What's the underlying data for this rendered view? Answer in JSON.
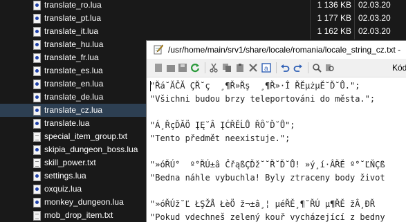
{
  "files": [
    {
      "name": "translate_ro.lua",
      "size": "1 136 KB",
      "date": "02.03.20",
      "type": "lua"
    },
    {
      "name": "translate_pt.lua",
      "size": "1 177 KB",
      "date": "02.03.20",
      "type": "lua"
    },
    {
      "name": "translate_it.lua",
      "size": "1 162 KB",
      "date": "02.03.20",
      "type": "lua"
    },
    {
      "name": "translate_hu.lua",
      "size": "",
      "date": "",
      "type": "lua"
    },
    {
      "name": "translate_fr.lua",
      "size": "",
      "date": "",
      "type": "lua"
    },
    {
      "name": "translate_es.lua",
      "size": "",
      "date": "",
      "type": "lua"
    },
    {
      "name": "translate_en.lua",
      "size": "",
      "date": "",
      "type": "lua"
    },
    {
      "name": "translate_de.lua",
      "size": "",
      "date": "",
      "type": "lua"
    },
    {
      "name": "translate_cz.lua",
      "size": "",
      "date": "",
      "type": "lua",
      "selected": true
    },
    {
      "name": "translate.lua",
      "size": "",
      "date": "",
      "type": "lua"
    },
    {
      "name": "special_item_group.txt",
      "size": "",
      "date": "",
      "type": "txt"
    },
    {
      "name": "skipia_dungeon_boss.lua",
      "size": "",
      "date": "",
      "type": "lua"
    },
    {
      "name": "skill_power.txt",
      "size": "",
      "date": "",
      "type": "txt"
    },
    {
      "name": "settings.lua",
      "size": "",
      "date": "",
      "type": "lua"
    },
    {
      "name": "oxquiz.lua",
      "size": "",
      "date": "",
      "type": "lua"
    },
    {
      "name": "monkey_dungeon.lua",
      "size": "",
      "date": "",
      "type": "lua"
    },
    {
      "name": "mob_drop_item.txt",
      "size": "",
      "date": "",
      "type": "txt"
    }
  ],
  "editor": {
    "title": "/usr/home/main/srv1/share/locale/romania/locale_string_cz.txt -",
    "toolbar_label": "Kód",
    "toolbar_icons": [
      "new-file-icon",
      "open-icon",
      "save-icon",
      "reload-icon",
      "cut-icon",
      "copy-icon",
      "paste-icon",
      "delete-icon",
      "select-all-icon",
      "undo-icon",
      "redo-icon",
      "search-icon",
      "replace-icon"
    ],
    "lines": [
      "\"Řá˘ĂČĂ ÇŘ˘ç  ¸¶Ř»Řş  ¸¶Ř»·Î ŘĚµżµĚ˘Ď˘Ů.\";",
      "\"Všichni budou brzy teleportováni do města.\";",
      "",
      "\"Á¸ŘçĎĂÖ ĮĘ˘Â ĮĆŘĚĹŮ ŘÔ˘Ď˘Ů\";",
      "\"Tento předmět neexistuje.\";",
      "",
      "\"»óŘÚ°  º°ŘÚ±â ĈřąßÇĎž˘˘Ř˘Ď˘Ů! »ý¸í·ÂŘĚ º°˘ĽŇÇß",
      "\"Bedna náhle vybuchla! Byly ztraceny body život",
      "",
      "\"»óŘÚž˘Ľ ŁŞŽÅ ŁèÖ ž¬±â¸¦ µéŘĚ¸¶˘ŘÚ µ¶ŘĚ žÂ¸ĐŘ",
      "\"Pokud vdechneš zelený kouř vycházející z bedny"
    ]
  }
}
